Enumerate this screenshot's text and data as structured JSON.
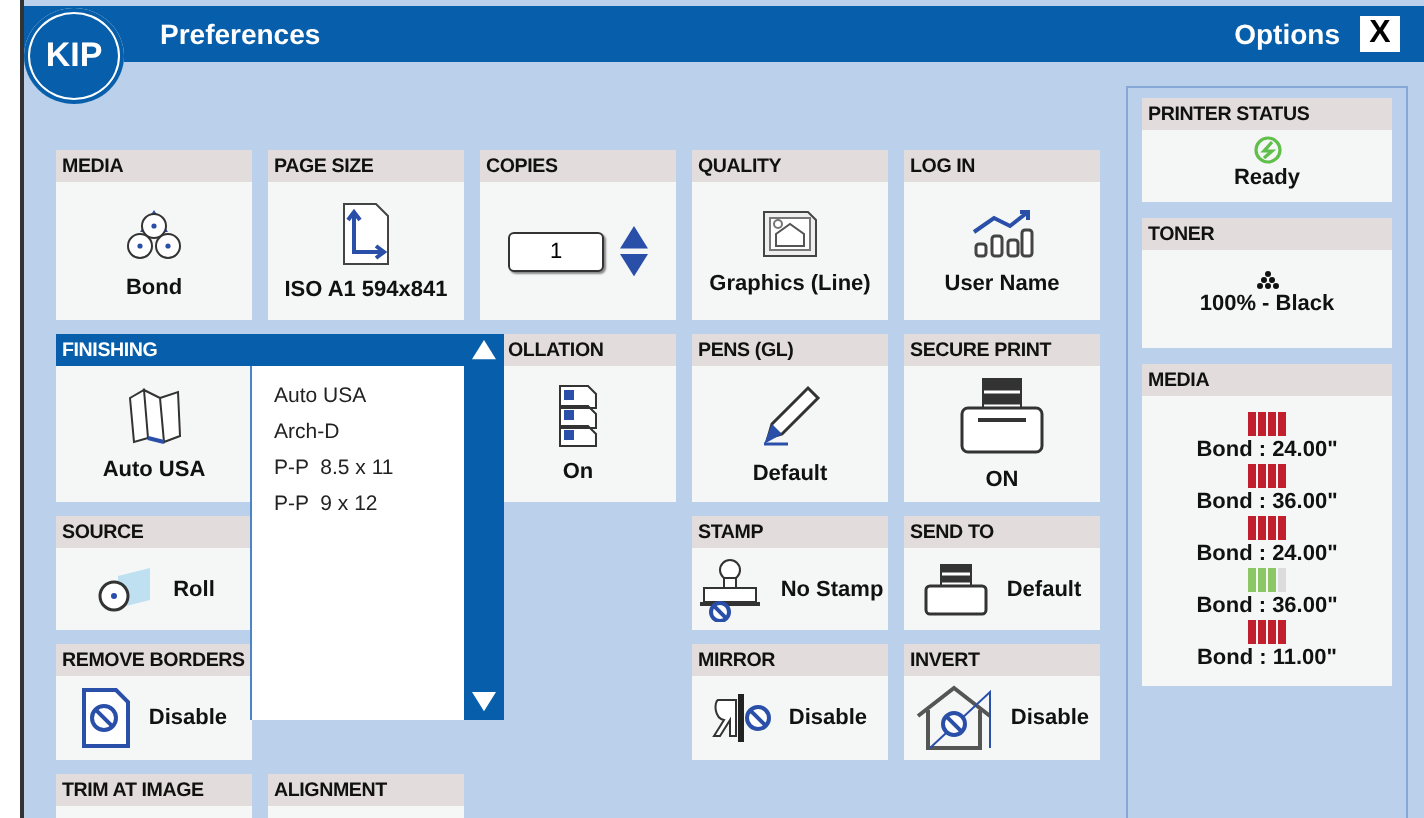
{
  "window": {
    "logo": "KIP",
    "title": "Preferences",
    "options_label": "Options",
    "close_label": "X"
  },
  "rows": [
    {
      "tiles": [
        {
          "label": "MEDIA",
          "value": "Bond",
          "kind": "stack"
        },
        {
          "label": "PAGE SIZE",
          "value": "ISO A1 594x841",
          "kind": "stack"
        },
        {
          "label": "COPIES",
          "value": "1",
          "kind": "spinner"
        },
        {
          "label": "QUALITY",
          "value": "Graphics (Line)",
          "kind": "stack"
        },
        {
          "label": "LOG IN",
          "value": "User Name",
          "kind": "stack"
        }
      ]
    },
    {
      "tiles": [
        {
          "label": "FINISHING",
          "value": "Auto USA",
          "kind": "dropdown",
          "expanded": true,
          "options": [
            "Auto USA",
            "Arch-D",
            "P-P  8.5 x 11",
            "P-P  9 x 12"
          ]
        },
        {
          "label": "OLLATION",
          "value": "On",
          "kind": "stack"
        },
        {
          "label": "PENS (GL)",
          "value": "Default",
          "kind": "stack"
        },
        {
          "label": "SECURE PRINT",
          "value": "ON",
          "kind": "stack"
        }
      ]
    },
    {
      "tiles": [
        {
          "label": "SOURCE",
          "value": "Roll",
          "kind": "inline"
        },
        {
          "label": "STAMP",
          "value": "No Stamp",
          "kind": "inline"
        },
        {
          "label": "SEND TO",
          "value": "Default",
          "kind": "inline"
        }
      ]
    },
    {
      "tiles": [
        {
          "label": "REMOVE BORDERS",
          "value": "Disable",
          "kind": "inline"
        },
        {
          "label": "MIRROR",
          "value": "Disable",
          "kind": "inline"
        },
        {
          "label": "INVERT",
          "value": "Disable",
          "kind": "inline"
        }
      ]
    },
    {
      "tiles": [
        {
          "label": "TRIM AT IMAGE",
          "kind": "cut"
        },
        {
          "label": "ALIGNMENT",
          "kind": "cut"
        }
      ]
    }
  ],
  "status": {
    "printer": {
      "label": "PRINTER STATUS",
      "value": "Ready"
    },
    "toner": {
      "label": "TONER",
      "value": "100% - Black"
    },
    "media": {
      "label": "MEDIA",
      "rolls": [
        {
          "name": "Bond : 24.00\"",
          "level": 1,
          "color": "#c21f2e"
        },
        {
          "name": "Bond : 36.00\"",
          "level": 1,
          "color": "#c21f2e"
        },
        {
          "name": "Bond : 24.00\"",
          "level": 1,
          "color": "#c21f2e"
        },
        {
          "name": "Bond : 36.00\"",
          "level": 0.75,
          "color": "#8cc765"
        },
        {
          "name": "Bond : 11.00\"",
          "level": 1,
          "color": "#c21f2e"
        }
      ]
    }
  }
}
